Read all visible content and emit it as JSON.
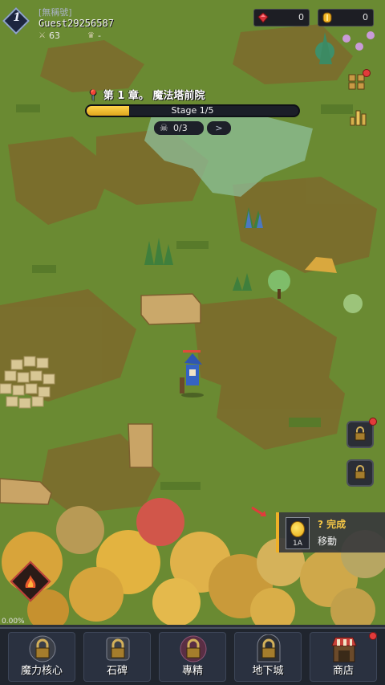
{
  "player": {
    "level": "1",
    "title_tag": "[無稱號]",
    "name": "Guest29256587",
    "power": "63",
    "rank": "-"
  },
  "currency": {
    "gems": "0",
    "gold": "0",
    "gem_icon": "red-gem-icon",
    "gold_icon": "gold-coin-icon"
  },
  "chapter": {
    "title": "第 1 章。 魔法塔前院",
    "stage_label": "Stage 1/5",
    "stage_progress": 0.2,
    "kills": "0/3"
  },
  "quest": {
    "status": "完成",
    "name": "移動",
    "reward_qty": "1A"
  },
  "bottom": {
    "progress_text": "0.00%",
    "nav": [
      {
        "label": "魔力核心",
        "icon": "lock-icon"
      },
      {
        "label": "石碑",
        "icon": "lock-icon"
      },
      {
        "label": "專精",
        "icon": "lock-icon"
      },
      {
        "label": "地下城",
        "icon": "lock-icon"
      },
      {
        "label": "商店",
        "icon": "shop-icon"
      }
    ]
  },
  "colors": {
    "accent_gold": "#f0b127",
    "grass": "#6f8f34",
    "dirt": "#7a6a2c",
    "alert_red": "#e23b3b"
  }
}
